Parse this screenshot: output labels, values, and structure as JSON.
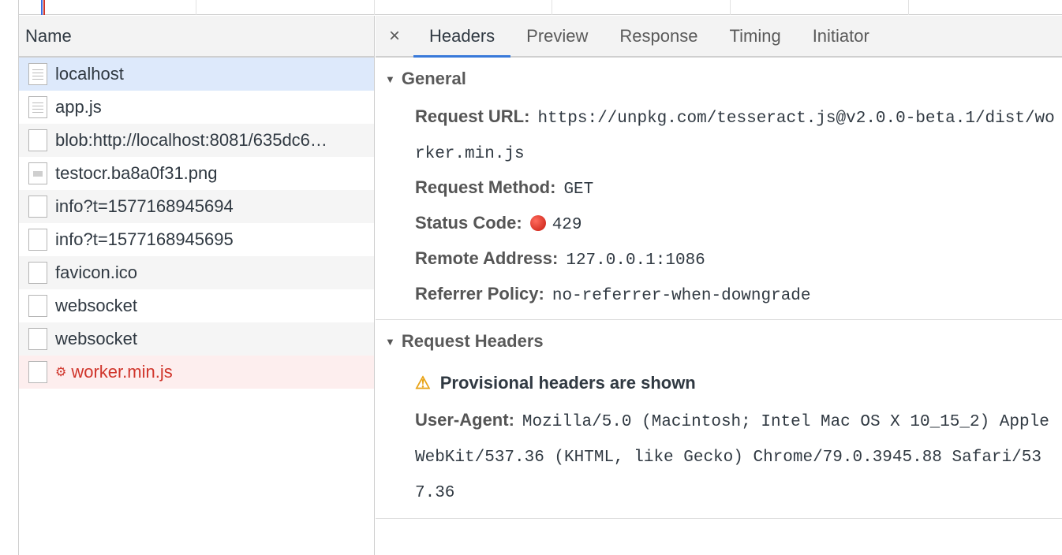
{
  "name_column": {
    "header": "Name"
  },
  "requests": [
    {
      "name": "localhost",
      "icon": "document-icon",
      "state": "selected"
    },
    {
      "name": "app.js",
      "icon": "script-icon",
      "state": "normal"
    },
    {
      "name": "blob:http://localhost:8081/635dc6…",
      "icon": "file-icon",
      "state": "normal"
    },
    {
      "name": "testocr.ba8a0f31.png",
      "icon": "image-icon",
      "state": "normal"
    },
    {
      "name": "info?t=1577168945694",
      "icon": "file-icon",
      "state": "normal"
    },
    {
      "name": "info?t=1577168945695",
      "icon": "file-icon",
      "state": "normal"
    },
    {
      "name": "favicon.ico",
      "icon": "file-icon",
      "state": "normal"
    },
    {
      "name": "websocket",
      "icon": "file-icon",
      "state": "normal"
    },
    {
      "name": "websocket",
      "icon": "file-icon",
      "state": "normal"
    },
    {
      "name": "worker.min.js",
      "icon": "file-icon",
      "state": "error"
    }
  ],
  "tabs": {
    "close": "×",
    "headers": "Headers",
    "preview": "Preview",
    "response": "Response",
    "timing": "Timing",
    "initiator": "Initiator"
  },
  "general": {
    "title": "General",
    "request_url_label": "Request URL:",
    "request_url": "https://unpkg.com/tesseract.js@v2.0.0-beta.1/dist/worker.min.js",
    "request_method_label": "Request Method:",
    "request_method": "GET",
    "status_code_label": "Status Code:",
    "status_code": "429",
    "remote_address_label": "Remote Address:",
    "remote_address": "127.0.0.1:1086",
    "referrer_policy_label": "Referrer Policy:",
    "referrer_policy": "no-referrer-when-downgrade"
  },
  "request_headers": {
    "title": "Request Headers",
    "warning": "Provisional headers are shown",
    "user_agent_label": "User-Agent:",
    "user_agent": "Mozilla/5.0 (Macintosh; Intel Mac OS X 10_15_2) AppleWebKit/537.36 (KHTML, like Gecko) Chrome/79.0.3945.88 Safari/537.36"
  },
  "colors": {
    "accent": "#3879d9",
    "error": "#d0352b",
    "selected_row": "#dde9fb"
  }
}
